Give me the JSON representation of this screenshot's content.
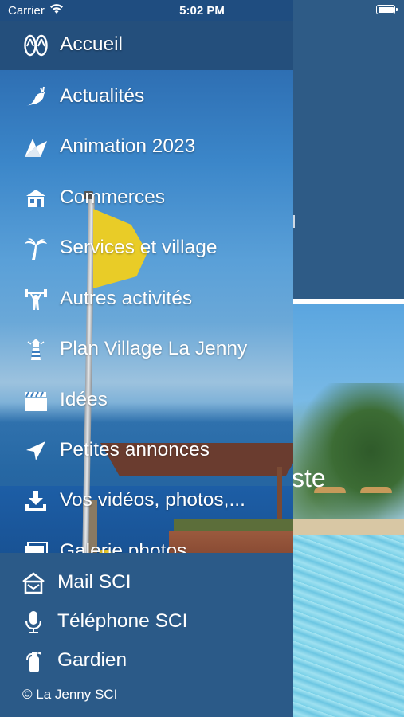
{
  "status_bar": {
    "carrier": "Carrier",
    "time": "5:02 PM",
    "wifi_icon": "wifi-icon",
    "battery_icon": "battery-icon"
  },
  "drawer": {
    "header_item": {
      "label": "Accueil",
      "icon": "flip-flops-icon"
    },
    "menu_items": [
      {
        "label": "Actualités",
        "icon": "bird-icon"
      },
      {
        "label": "Animation 2023",
        "icon": "paper-plane-origami-icon"
      },
      {
        "label": "Commerces",
        "icon": "shop-icon"
      },
      {
        "label": "Services et village",
        "icon": "palm-tree-icon"
      },
      {
        "label": "Autres activités",
        "icon": "weightlifting-icon"
      },
      {
        "label": "Plan Village La Jenny",
        "icon": "lighthouse-icon"
      },
      {
        "label": "Idées",
        "icon": "clapperboard-icon"
      },
      {
        "label": "Petites annonces",
        "icon": "send-icon"
      },
      {
        "label": "Vos vidéos, photos,...",
        "icon": "download-icon"
      },
      {
        "label": "Galerie photos",
        "icon": "photo-gallery-icon"
      }
    ],
    "footer_items": [
      {
        "label": "Mail SCI",
        "icon": "house-mail-icon"
      },
      {
        "label": "Téléphone SCI",
        "icon": "microphone-icon"
      },
      {
        "label": "Gardien",
        "icon": "fire-extinguisher-icon"
      }
    ],
    "copyright": "© La Jenny SCI"
  },
  "background": {
    "partial_text": "ste"
  },
  "colors": {
    "drawer_header": "#244f7c",
    "drawer_footer": "#2b5a88",
    "app_background": "#2e5b86",
    "text": "#ffffff"
  }
}
